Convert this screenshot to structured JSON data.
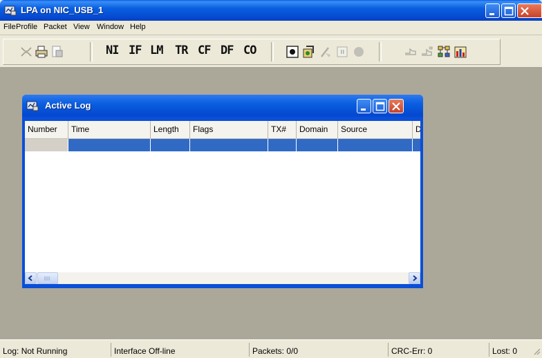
{
  "window": {
    "title": "LPA on NIC_USB_1"
  },
  "menu": [
    {
      "label": "File"
    },
    {
      "label": "Profile"
    },
    {
      "label": "Packet"
    },
    {
      "label": "View"
    },
    {
      "label": "Window"
    },
    {
      "label": "Help"
    }
  ],
  "toolbar": {
    "text_buttons": [
      "NI",
      "IF",
      "LM",
      "TR",
      "CF",
      "DF",
      "CO"
    ],
    "icons": [
      "network-icon",
      "print-icon",
      "print-preview-icon",
      "record-icon",
      "capture-settings-icon",
      "clear-icon",
      "pause-icon",
      "stop-icon",
      "filter-icon",
      "filter-set-icon",
      "network-map-icon",
      "statistics-icon"
    ]
  },
  "child": {
    "title": "Active Log",
    "columns": [
      "Number",
      "Time",
      "Length",
      "Flags",
      "TX#",
      "Domain",
      "Source",
      "D"
    ]
  },
  "status": {
    "log": "Log: Not Running",
    "interface": "Interface Off-line",
    "packets": "Packets: 0/0",
    "crc": "CRC-Err: 0",
    "lost": "Lost: 0"
  },
  "colors": {
    "titlebar": "#0a5fe0",
    "selection": "#316ac5",
    "mdi_background": "#aba899"
  }
}
